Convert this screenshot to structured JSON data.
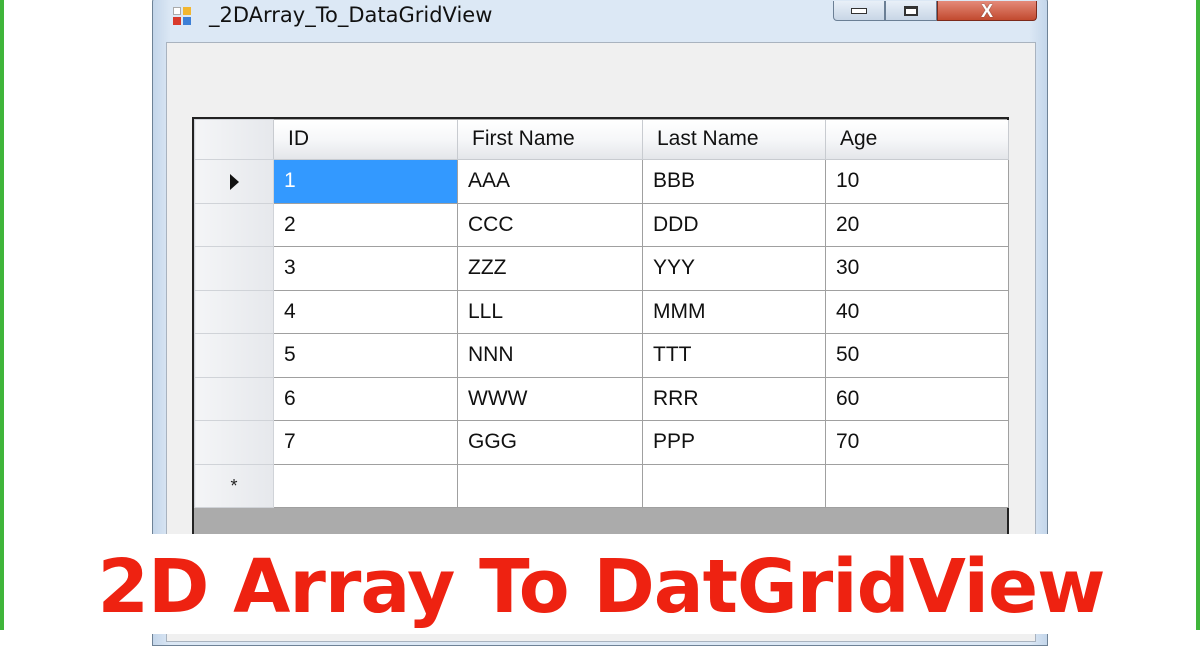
{
  "window": {
    "title": "_2DArray_To_DataGridView",
    "icon": "winforms-app-icon",
    "controls": {
      "minimize": "minimize-icon",
      "maximize": "maximize-icon",
      "close": "X"
    }
  },
  "grid": {
    "columns": [
      "ID",
      "First Name",
      "Last Name",
      "Age"
    ],
    "rows": [
      [
        "1",
        "AAA",
        "BBB",
        "10"
      ],
      [
        "2",
        "CCC",
        "DDD",
        "20"
      ],
      [
        "3",
        "ZZZ",
        "YYY",
        "30"
      ],
      [
        "4",
        "LLL",
        "MMM",
        "40"
      ],
      [
        "5",
        "NNN",
        "TTT",
        "50"
      ],
      [
        "6",
        "WWW",
        "RRR",
        "60"
      ],
      [
        "7",
        "GGG",
        "PPP",
        "70"
      ]
    ],
    "current_row_indicator": "row-pointer-arrow-icon",
    "new_row_marker": "*",
    "selected_cell_color": "#3399ff"
  },
  "banner": {
    "text": "2D Array To DatGridView",
    "color": "#ee2211"
  },
  "colors": {
    "frame_green": "#3fb53a"
  }
}
